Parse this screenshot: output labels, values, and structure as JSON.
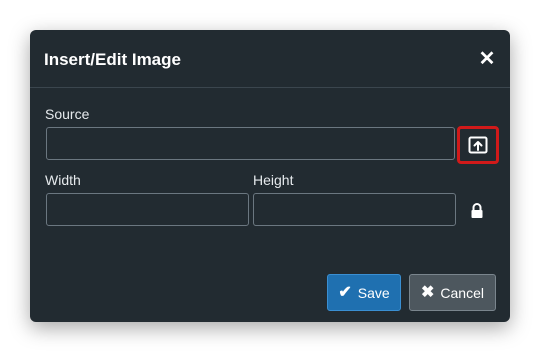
{
  "dialog": {
    "title": "Insert/Edit Image",
    "close_icon": "close-icon"
  },
  "form": {
    "source_label": "Source",
    "source_value": "",
    "browse_icon": "upload-icon",
    "width_label": "Width",
    "width_value": "",
    "height_label": "Height",
    "height_value": "",
    "lock_icon": "lock-icon"
  },
  "footer": {
    "save_label": "Save",
    "save_icon": "check-icon",
    "cancel_label": "Cancel",
    "cancel_icon": "x-icon"
  },
  "colors": {
    "dialog_bg": "#222b31",
    "primary": "#1f70b0",
    "highlight": "#d11a1a"
  }
}
